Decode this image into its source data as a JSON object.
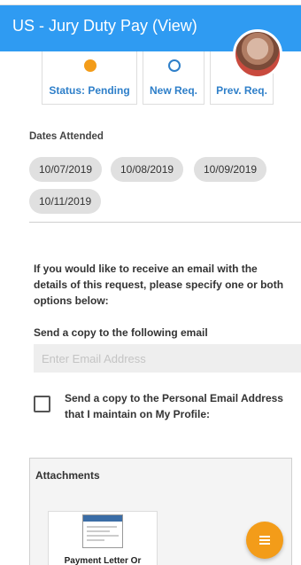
{
  "header": {
    "title": "US - Jury Duty Pay (View)"
  },
  "status_cards": [
    {
      "label": "Status: Pending",
      "icon": "pending-dot-icon",
      "color": "#f39c19"
    },
    {
      "label": "New Req.",
      "icon": "new-circle-icon",
      "color": "#2e7fc9"
    },
    {
      "label": "Prev. Req.",
      "icon": "",
      "color": "#2e7fc9"
    }
  ],
  "dates": {
    "title": "Dates Attended",
    "chips": [
      "10/07/2019",
      "10/08/2019",
      "10/09/2019",
      "10/11/2019"
    ]
  },
  "email_section": {
    "info": "If you would like to receive an email with the details of this request, please specify one or both options below:",
    "send_copy_label": "Send a copy to the following email",
    "email_placeholder": "Enter Email Address",
    "email_value": "",
    "personal_checkbox_label": "Send a copy to the Personal Email Address that I maintain on My Profile:",
    "personal_checked": false
  },
  "attachments": {
    "title": "Attachments",
    "items": [
      {
        "name": "Payment Letter Or"
      }
    ]
  },
  "colors": {
    "header": "#2f9bf2",
    "accent": "#f39c19",
    "link": "#2e7fc9"
  },
  "fab": {
    "icon": "menu-lines-icon"
  }
}
